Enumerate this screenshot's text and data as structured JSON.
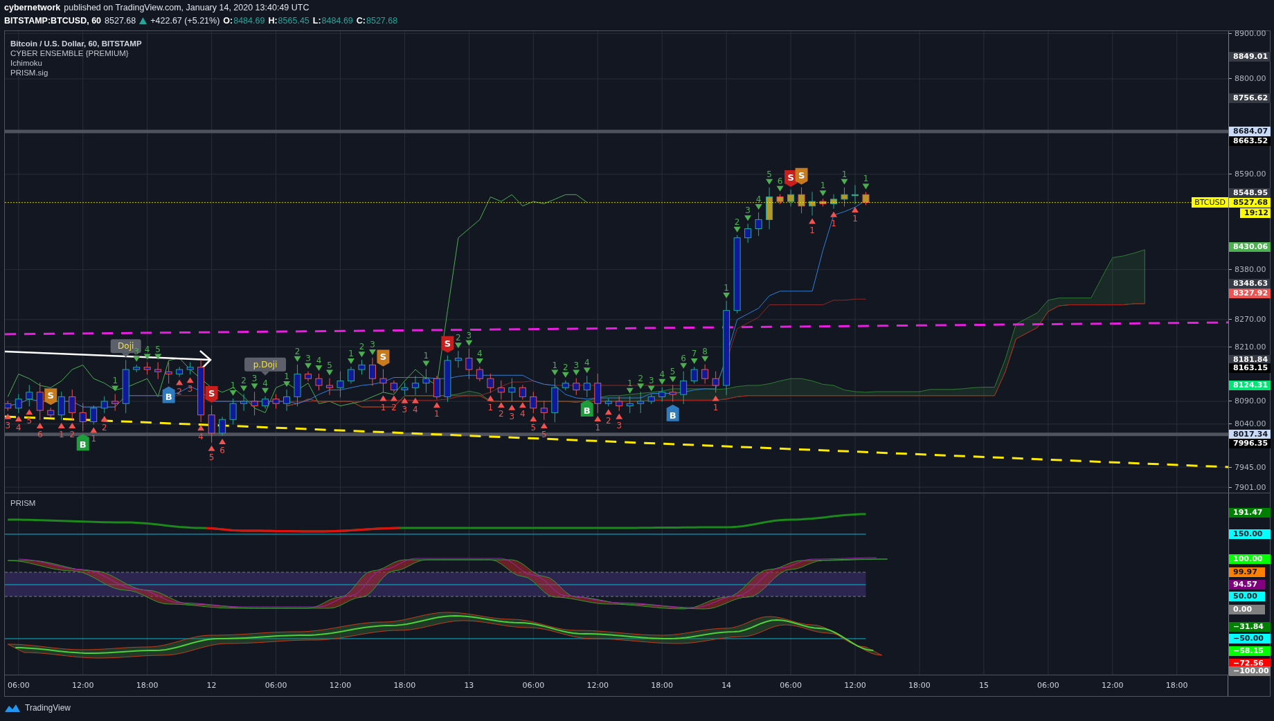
{
  "header": {
    "author": "cybernetwork",
    "published": "published on TradingView.com, January 14, 2020 13:40:49 UTC",
    "symbol": "BITSTAMP:BTCUSD, 60",
    "price": "8527.68",
    "rising": true,
    "change": "+422.67 (+5.21%)",
    "ohlc": [
      {
        "label": "O:",
        "value": "8484.69"
      },
      {
        "label": "H:",
        "value": "8565.45"
      },
      {
        "label": "L:",
        "value": "8484.69"
      },
      {
        "label": "C:",
        "value": "8527.68"
      }
    ]
  },
  "legend": [
    {
      "kind": "title",
      "text": "Bitcoin / U.S. Dollar, 60, BITSTAMP"
    },
    {
      "kind": "indicator",
      "text": "CYBER ENSEMBLE {PREMIUM}"
    },
    {
      "kind": "indicator",
      "text": "Ichimoku"
    },
    {
      "kind": "indicator",
      "text": "PRISM.sig"
    }
  ],
  "main_chart": {
    "price_axis": [
      "8900.00",
      "8800.00",
      "8590.00",
      "8380.00",
      "8270.00",
      "8210.00",
      "8090.00",
      "8040.00",
      "7945.00",
      "7901.00"
    ],
    "time_axis": [
      "06:00",
      "12:00",
      "18:00",
      "12",
      "06:00",
      "12:00",
      "18:00",
      "13",
      "06:00",
      "12:00",
      "18:00",
      "14",
      "06:00",
      "12:00",
      "18:00",
      "15",
      "06:00",
      "12:00",
      "18:00"
    ],
    "price_tags": [
      {
        "label": "8849.01",
        "color": "#363a45"
      },
      {
        "label": "8756.62",
        "color": "#363a45"
      },
      {
        "label": "8684.07",
        "color": "#c9daf8"
      },
      {
        "label": "8663.52",
        "color": "#000000"
      },
      {
        "label": "8548.95",
        "color": "#363a45"
      },
      {
        "label": "8430.06",
        "color": "#4caf50"
      },
      {
        "label": "8348.63",
        "color": "#363a45"
      },
      {
        "label": "8327.92",
        "color": "#f05350"
      },
      {
        "label": "8181.84",
        "color": "#363a45"
      },
      {
        "label": "8163.15",
        "color": "#000000"
      },
      {
        "label": "8124.31",
        "color": "#00e676"
      },
      {
        "label": "8017.34",
        "color": "#c9daf8"
      },
      {
        "label": "7996.35",
        "color": "#000000"
      }
    ],
    "last_price": {
      "label": "8527.68",
      "name": "BTCUSD",
      "countdown": "19:12",
      "color": "#ffff00"
    },
    "bars": [
      {
        "kind": "down",
        "buy_count": "3"
      },
      {
        "kind": "up",
        "buy_count": "4"
      },
      {
        "kind": "up",
        "buy_count": "5"
      },
      {
        "kind": "down",
        "buy_count": "6"
      },
      {
        "kind": "down",
        "signal": {
          "kind": "sell",
          "label": "S",
          "color": "#c87a1e"
        }
      },
      {
        "kind": "up",
        "buy_count": "1"
      },
      {
        "kind": "down",
        "buy_count": "2"
      },
      {
        "kind": "down",
        "signal": {
          "kind": "buy",
          "label": "B",
          "color": "#1e9e3a"
        }
      },
      {
        "kind": "up",
        "buy_count": "1"
      },
      {
        "kind": "up",
        "buy_count": "2"
      },
      {
        "kind": "down",
        "sell_count": "1"
      },
      {
        "kind": "up",
        "pattern": "Doji"
      },
      {
        "kind": "up",
        "sell_count": "3"
      },
      {
        "kind": "down",
        "sell_count": "4"
      },
      {
        "kind": "down",
        "sell_count": "5"
      },
      {
        "kind": "down",
        "signal": {
          "kind": "buy",
          "label": "B",
          "color": "#2e7bbf"
        }
      },
      {
        "kind": "up",
        "buy_count": "2"
      },
      {
        "kind": "up",
        "buy_count": "3"
      },
      {
        "kind": "down",
        "buy_count": "4"
      },
      {
        "kind": "down",
        "buy_count": "5",
        "signal": {
          "kind": "sell",
          "label": "S",
          "color": "#c81e1e"
        }
      },
      {
        "kind": "up",
        "buy_count": "6"
      },
      {
        "kind": "up",
        "sell_count": "1"
      },
      {
        "kind": "up",
        "sell_count": "2"
      },
      {
        "kind": "down",
        "sell_count": "3"
      },
      {
        "kind": "up",
        "sell_count": "4",
        "pattern": "p.Doji"
      },
      {
        "kind": "down"
      },
      {
        "kind": "up",
        "sell_count": "1"
      },
      {
        "kind": "up",
        "sell_count": "2"
      },
      {
        "kind": "down",
        "sell_count": "3"
      },
      {
        "kind": "down",
        "sell_count": "4"
      },
      {
        "kind": "down",
        "sell_count": "5"
      },
      {
        "kind": "up"
      },
      {
        "kind": "up",
        "sell_count": "1"
      },
      {
        "kind": "up",
        "sell_count": "2"
      },
      {
        "kind": "down",
        "sell_count": "3"
      },
      {
        "kind": "down",
        "buy_count": "1",
        "signal": {
          "kind": "sell",
          "label": "S",
          "color": "#c87a1e"
        }
      },
      {
        "kind": "down",
        "buy_count": "2"
      },
      {
        "kind": "up",
        "buy_count": "3"
      },
      {
        "kind": "up",
        "buy_count": "4"
      },
      {
        "kind": "up",
        "sell_count": "1"
      },
      {
        "kind": "down",
        "buy_count": "1"
      },
      {
        "kind": "up",
        "signal": {
          "kind": "sell",
          "label": "S",
          "color": "#c81e1e"
        }
      },
      {
        "kind": "up",
        "sell_count": "2"
      },
      {
        "kind": "down",
        "sell_count": "3"
      },
      {
        "kind": "down",
        "sell_count": "4"
      },
      {
        "kind": "down",
        "buy_count": "1"
      },
      {
        "kind": "down",
        "buy_count": "2"
      },
      {
        "kind": "up",
        "buy_count": "3"
      },
      {
        "kind": "down",
        "buy_count": "4"
      },
      {
        "kind": "down",
        "buy_count": "5"
      },
      {
        "kind": "down",
        "buy_count": "5"
      },
      {
        "kind": "up",
        "sell_count": "1"
      },
      {
        "kind": "up",
        "sell_count": "2"
      },
      {
        "kind": "down",
        "sell_count": "3"
      },
      {
        "kind": "up",
        "sell_count": "4",
        "signal": {
          "kind": "buy",
          "label": "B",
          "color": "#1e9e3a"
        }
      },
      {
        "kind": "down",
        "buy_count": "1"
      },
      {
        "kind": "up",
        "buy_count": "2"
      },
      {
        "kind": "down",
        "buy_count": "3"
      },
      {
        "kind": "up",
        "sell_count": "1"
      },
      {
        "kind": "up",
        "sell_count": "2"
      },
      {
        "kind": "up",
        "sell_count": "3"
      },
      {
        "kind": "up",
        "sell_count": "4"
      },
      {
        "kind": "down",
        "sell_count": "5",
        "signal": {
          "kind": "buy",
          "label": "B",
          "color": "#2e7bbf"
        }
      },
      {
        "kind": "up",
        "sell_count": "6"
      },
      {
        "kind": "up",
        "sell_count": "7"
      },
      {
        "kind": "down",
        "sell_count": "8"
      },
      {
        "kind": "down",
        "buy_count": "1"
      },
      {
        "kind": "up",
        "sell_count": "1"
      },
      {
        "kind": "up",
        "sell_count": "2"
      },
      {
        "kind": "up",
        "sell_count": "3"
      },
      {
        "kind": "up",
        "sell_count": "4"
      },
      {
        "kind": "up",
        "sell_count": "5"
      },
      {
        "kind": "down",
        "sell_count": "6"
      },
      {
        "kind": "up",
        "signal": {
          "kind": "sell",
          "label": "S",
          "color": "#c81e1e"
        }
      },
      {
        "kind": "down",
        "signal": {
          "kind": "sell",
          "label": "S",
          "color": "#c87a1e"
        }
      },
      {
        "kind": "up",
        "buy_count": "1"
      },
      {
        "kind": "down",
        "sell_count": "1"
      },
      {
        "kind": "up",
        "buy_count": "1"
      },
      {
        "kind": "up",
        "sell_count": "1"
      },
      {
        "kind": "up",
        "buy_count": "1"
      },
      {
        "kind": "down",
        "sell_count": "1"
      }
    ]
  },
  "prism": {
    "title": "PRISM",
    "tags": [
      {
        "label": "191.47",
        "color": "#008000"
      },
      {
        "label": "150.00",
        "color": "#00ffff"
      },
      {
        "label": "100.00",
        "color": "#00ff00"
      },
      {
        "label": "99.97",
        "color": "#ff8000"
      },
      {
        "label": "94.57",
        "color": "#800080"
      },
      {
        "label": "50.00",
        "color": "#00ffff"
      },
      {
        "label": "0.00",
        "color": "#808080"
      },
      {
        "label": "−31.84",
        "color": "#008000"
      },
      {
        "label": "−50.00",
        "color": "#00ffff"
      },
      {
        "label": "−58.15",
        "color": "#00ff00"
      },
      {
        "label": "−72.56",
        "color": "#ff0000"
      },
      {
        "label": "−100.00",
        "color": "#808080"
      }
    ]
  },
  "footer": {
    "brand": "TradingView"
  }
}
